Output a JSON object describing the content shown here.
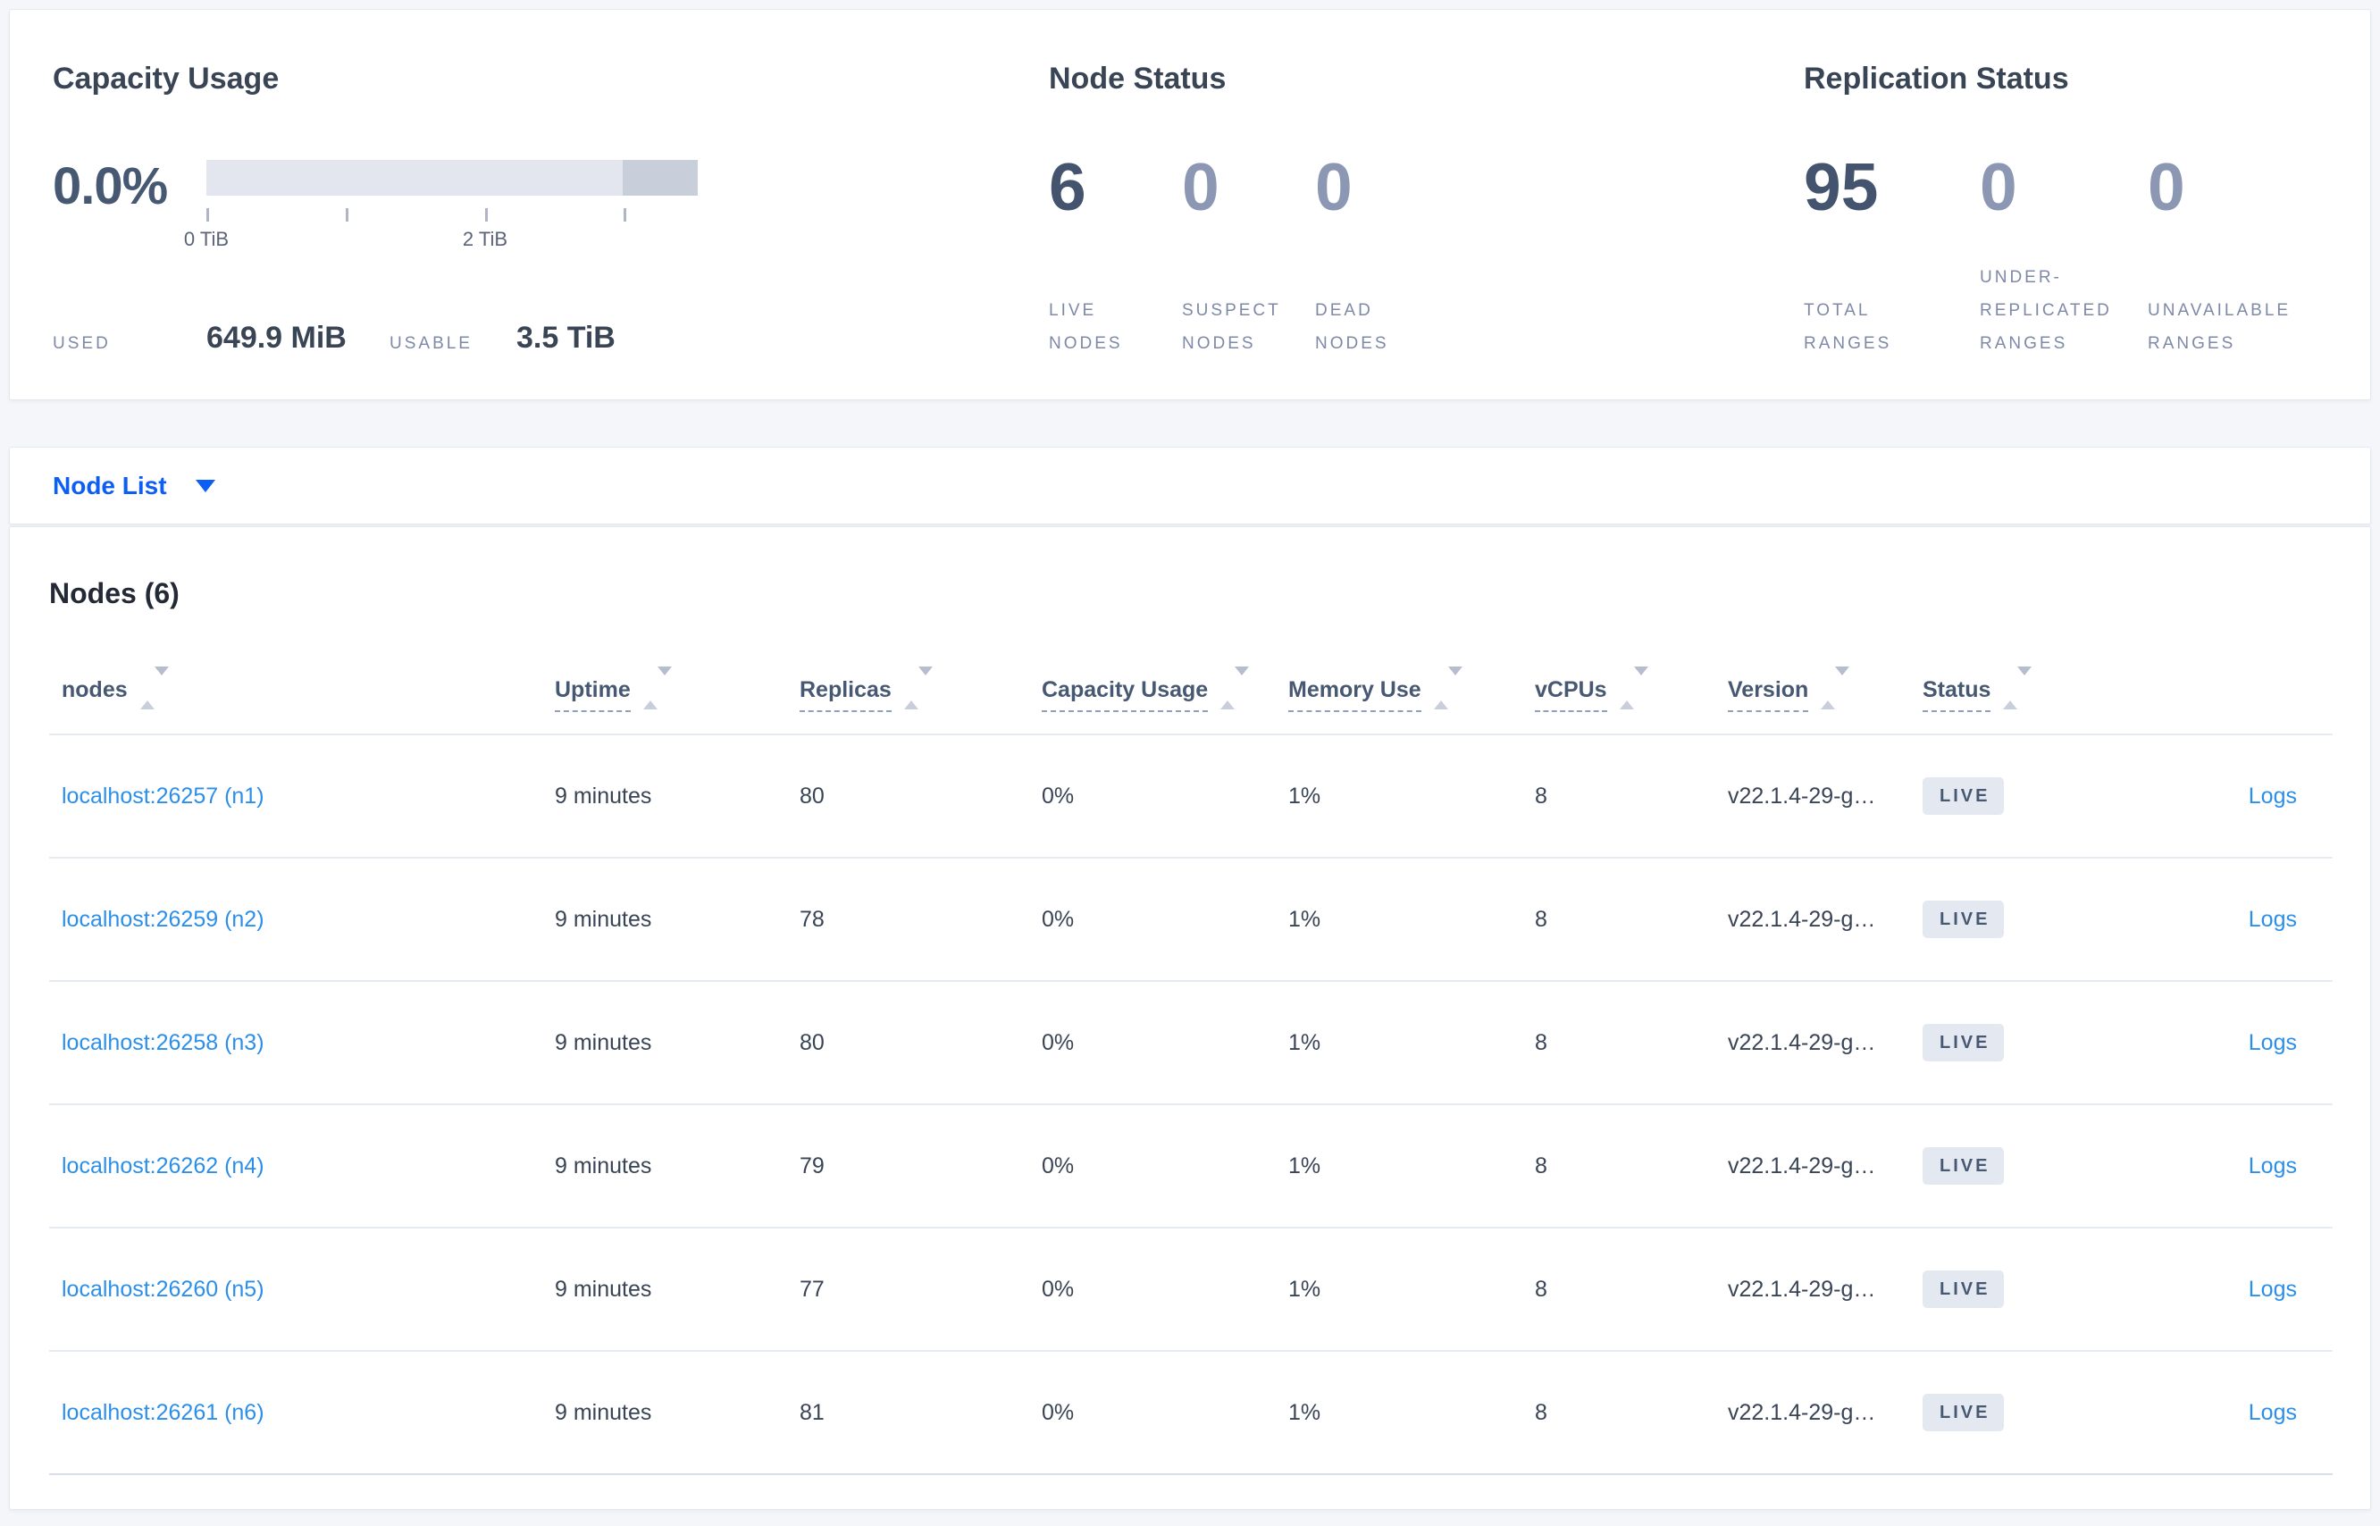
{
  "colors": {
    "page_bg": "#f4f6fa",
    "accent_blue": "#0d5ef5",
    "link_blue": "#2b8fea",
    "dark_slate": "#475872",
    "muted_stat": "#8c97b4",
    "label_gray": "#7d89a7",
    "bar_track": "#e3e6ee",
    "bar_dark_segment": "#c9cedb",
    "badge_bg": "#e4e9f1"
  },
  "capacity": {
    "title": "Capacity Usage",
    "percent": "0.0%",
    "tick_label_0": "0 TiB",
    "tick_label_2": "2 TiB",
    "used_label": "USED",
    "used_value": "649.9 MiB",
    "usable_label": "USABLE",
    "usable_value": "3.5 TiB"
  },
  "node_status": {
    "title": "Node Status",
    "stats": [
      {
        "value": "6",
        "label": "LIVE NODES"
      },
      {
        "value": "0",
        "label": "SUSPECT NODES"
      },
      {
        "value": "0",
        "label": "DEAD NODES"
      }
    ]
  },
  "replication_status": {
    "title": "Replication Status",
    "stats": [
      {
        "value": "95",
        "label": "TOTAL RANGES"
      },
      {
        "value": "0",
        "label": "UNDER-REPLICATED RANGES"
      },
      {
        "value": "0",
        "label": "UNAVAILABLE RANGES"
      }
    ]
  },
  "node_list": {
    "label": "Node List"
  },
  "nodes_table": {
    "heading": "Nodes (6)",
    "columns": [
      {
        "label": "nodes"
      },
      {
        "label": "Uptime"
      },
      {
        "label": "Replicas"
      },
      {
        "label": "Capacity Usage"
      },
      {
        "label": "Memory Use"
      },
      {
        "label": "vCPUs"
      },
      {
        "label": "Version"
      },
      {
        "label": "Status"
      }
    ],
    "logs_label": "Logs",
    "rows": [
      {
        "node": "localhost:26257 (n1)",
        "uptime": "9 minutes",
        "replicas": "80",
        "capacity": "0%",
        "memory": "1%",
        "vcpus": "8",
        "version": "v22.1.4-29-g…",
        "status": "LIVE",
        "logs": "Logs"
      },
      {
        "node": "localhost:26259 (n2)",
        "uptime": "9 minutes",
        "replicas": "78",
        "capacity": "0%",
        "memory": "1%",
        "vcpus": "8",
        "version": "v22.1.4-29-g…",
        "status": "LIVE",
        "logs": "Logs"
      },
      {
        "node": "localhost:26258 (n3)",
        "uptime": "9 minutes",
        "replicas": "80",
        "capacity": "0%",
        "memory": "1%",
        "vcpus": "8",
        "version": "v22.1.4-29-g…",
        "status": "LIVE",
        "logs": "Logs"
      },
      {
        "node": "localhost:26262 (n4)",
        "uptime": "9 minutes",
        "replicas": "79",
        "capacity": "0%",
        "memory": "1%",
        "vcpus": "8",
        "version": "v22.1.4-29-g…",
        "status": "LIVE",
        "logs": "Logs"
      },
      {
        "node": "localhost:26260 (n5)",
        "uptime": "9 minutes",
        "replicas": "77",
        "capacity": "0%",
        "memory": "1%",
        "vcpus": "8",
        "version": "v22.1.4-29-g…",
        "status": "LIVE",
        "logs": "Logs"
      },
      {
        "node": "localhost:26261 (n6)",
        "uptime": "9 minutes",
        "replicas": "81",
        "capacity": "0%",
        "memory": "1%",
        "vcpus": "8",
        "version": "v22.1.4-29-g…",
        "status": "LIVE",
        "logs": "Logs"
      }
    ]
  }
}
